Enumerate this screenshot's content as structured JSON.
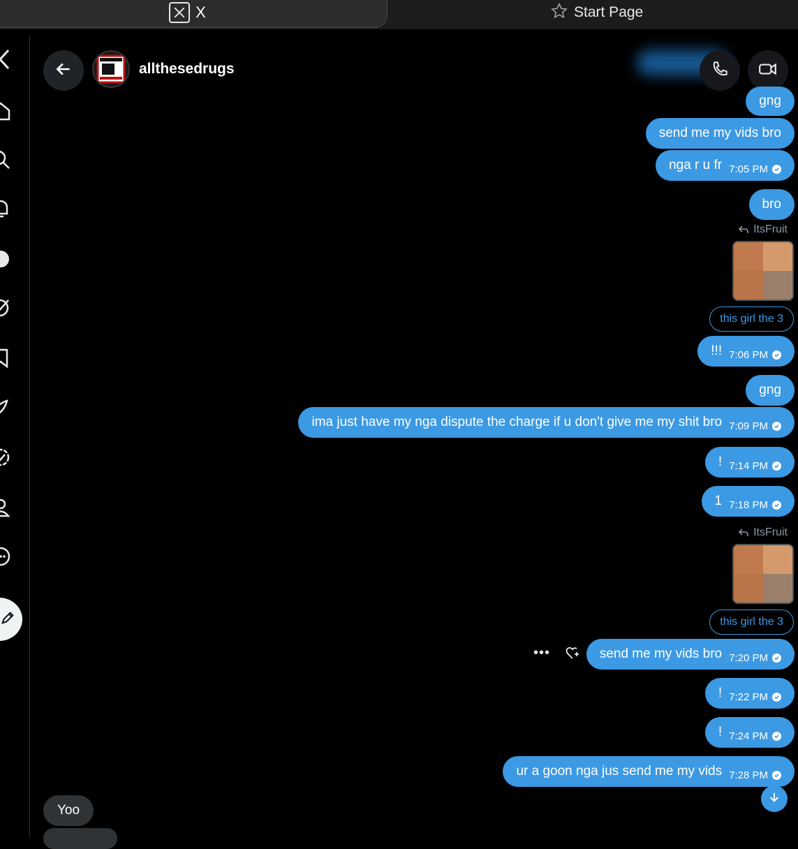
{
  "browser": {
    "active_tab_title": "X",
    "start_tab_title": "Start Page"
  },
  "header": {
    "username": "allthesedrugs"
  },
  "messages": [
    {
      "text": "gng",
      "time": ""
    },
    {
      "text": "send me my vids bro",
      "time": ""
    },
    {
      "text": "nga r u fr",
      "time": "7:05 PM"
    },
    {
      "text": "bro",
      "time": ""
    },
    {
      "reply_to": "ItsFruit",
      "quoted": "this girl the 3"
    },
    {
      "text": "!!!",
      "time": "7:06 PM"
    },
    {
      "text": "gng",
      "time": ""
    },
    {
      "text": "ima just have my nga dispute the charge if u don't give me my shit bro",
      "time": "7:09 PM"
    },
    {
      "text": "!",
      "time": "7:14 PM"
    },
    {
      "text": "1",
      "time": "7:18 PM"
    },
    {
      "reply_to": "ItsFruit",
      "quoted": "this girl the 3"
    },
    {
      "text": "send me my vids bro",
      "time": "7:20 PM"
    },
    {
      "text": "!",
      "time": "7:22 PM"
    },
    {
      "text": "!",
      "time": "7:24 PM"
    },
    {
      "text": "ur a goon nga jus send me my vids",
      "time": "7:28 PM"
    }
  ],
  "incoming": [
    {
      "text": "Yoo"
    }
  ],
  "colors": {
    "bubble": "#3c99e3",
    "background": "#000000",
    "incoming_bubble": "#2f3336"
  },
  "icons": {
    "nav": [
      "x-logo-icon",
      "home-icon",
      "search-icon",
      "bell-icon",
      "grok-icon",
      "communities-icon",
      "bookmark-icon",
      "premium-icon",
      "verified-icon",
      "profile-icon",
      "more-icon"
    ]
  }
}
